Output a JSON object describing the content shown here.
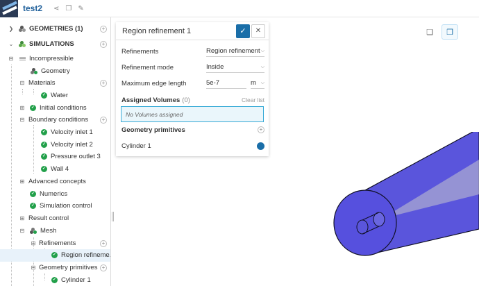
{
  "project": {
    "title": "test2"
  },
  "tree": {
    "geometries": {
      "label": "GEOMETRIES (1)"
    },
    "simulations": {
      "label": "SIMULATIONS"
    },
    "incompressible": {
      "label": "Incompressible"
    },
    "geometry": {
      "label": "Geometry"
    },
    "materials": {
      "label": "Materials"
    },
    "water": {
      "label": "Water"
    },
    "initial_conditions": {
      "label": "Initial conditions"
    },
    "boundary_conditions": {
      "label": "Boundary conditions"
    },
    "velocity_inlet_1": {
      "label": "Velocity inlet 1"
    },
    "velocity_inlet_2": {
      "label": "Velocity inlet 2"
    },
    "pressure_outlet_3": {
      "label": "Pressure outlet 3"
    },
    "wall_4": {
      "label": "Wall 4"
    },
    "advanced_concepts": {
      "label": "Advanced concepts"
    },
    "numerics": {
      "label": "Numerics"
    },
    "simulation_control": {
      "label": "Simulation control"
    },
    "result_control": {
      "label": "Result control"
    },
    "mesh": {
      "label": "Mesh"
    },
    "refinements": {
      "label": "Refinements"
    },
    "region_refinement": {
      "label": "Region refineme..."
    },
    "geometry_primitives": {
      "label": "Geometry primitives"
    },
    "cylinder_1": {
      "label": "Cylinder 1"
    }
  },
  "panel": {
    "title": "Region refinement 1",
    "refinements_label": "Refinements",
    "refinements_value": "Region refinement",
    "mode_label": "Refinement mode",
    "mode_value": "Inside",
    "edge_label": "Maximum edge length",
    "edge_value": "5e-7",
    "edge_unit": "m",
    "assigned_label": "Assigned Volumes",
    "assigned_count": "(0)",
    "clear_label": "Clear list",
    "no_volumes": "No Volumes assigned",
    "primitives_label": "Geometry primitives",
    "cylinder_label": "Cylinder 1",
    "cylinder_enabled": true
  },
  "colors": {
    "accent": "#1a6ea8",
    "success": "#22a04a",
    "selection": "#34a9d6",
    "model_fill": "#5450d8"
  },
  "icons": {
    "share": "share-icon",
    "copy": "copy-icon",
    "edit": "pencil-icon",
    "confirm": "check-icon",
    "close": "close-icon",
    "view_cube": "cube-icon",
    "view_iso": "iso-cube-icon"
  }
}
